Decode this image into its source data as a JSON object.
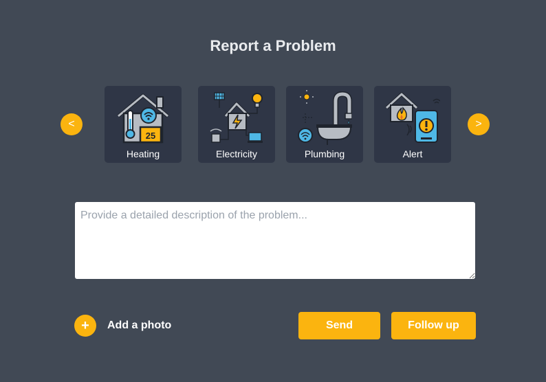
{
  "title": "Report a Problem",
  "carousel": {
    "prev_label": "<",
    "next_label": ">",
    "categories": [
      {
        "label": "Heating",
        "icon": "heating-icon"
      },
      {
        "label": "Electricity",
        "icon": "electricity-icon"
      },
      {
        "label": "Plumbing",
        "icon": "plumbing-icon"
      },
      {
        "label": "Alert",
        "icon": "alert-icon"
      }
    ]
  },
  "description": {
    "placeholder": "Provide a detailed description of the problem...",
    "value": ""
  },
  "add_photo": {
    "icon_label": "+",
    "label": "Add a photo"
  },
  "actions": {
    "send_label": "Send",
    "follow_up_label": "Follow up"
  },
  "heating_display": "25",
  "colors": {
    "background": "#414955",
    "card": "#2f3646",
    "accent": "#fbb40f",
    "icon_blue": "#4fb8e6",
    "icon_gray": "#b7bcc3"
  }
}
